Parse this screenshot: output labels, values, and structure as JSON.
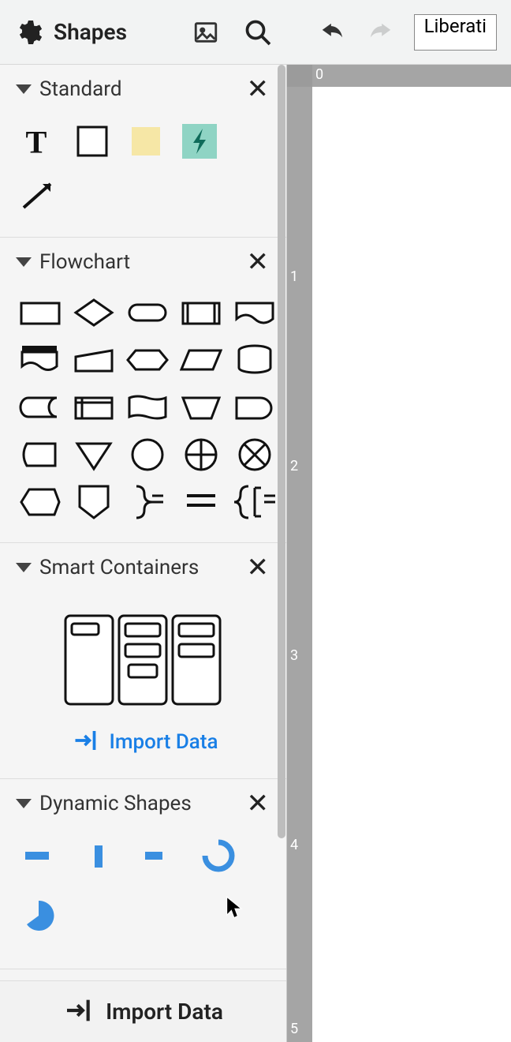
{
  "topbar": {
    "title": "Shapes",
    "font_select_value": "Liberati"
  },
  "sections": {
    "standard": {
      "title": "Standard",
      "shapes": [
        "text-tool",
        "rectangle",
        "sticky-note",
        "lightning",
        "arrow"
      ]
    },
    "flowchart": {
      "title": "Flowchart",
      "shapes": [
        "process",
        "decision",
        "terminator",
        "predefined-process",
        "document",
        "multi-document",
        "manual-input",
        "preparation",
        "data-io",
        "database",
        "stored-data",
        "internal-storage",
        "display",
        "manual-operation",
        "delay",
        "off-page",
        "merge",
        "connector",
        "summing-junction",
        "or-junction",
        "hexagon",
        "offpage-down",
        "brace-right",
        "parallel-lines",
        "brace-left-bracket"
      ]
    },
    "smart_containers": {
      "title": "Smart Containers",
      "import_label": "Import Data"
    },
    "dynamic_shapes": {
      "title": "Dynamic Shapes",
      "shapes": [
        "bar-h",
        "bar-v",
        "bar-short",
        "donut-arc",
        "pie-slice"
      ]
    }
  },
  "bottom_import_label": "Import Data",
  "ruler": {
    "h_ticks": [
      {
        "label": "0",
        "pos": 4
      }
    ],
    "v_ticks": [
      {
        "label": "1",
        "pos": 230
      },
      {
        "label": "2",
        "pos": 470
      },
      {
        "label": "3",
        "pos": 710
      },
      {
        "label": "4",
        "pos": 950
      },
      {
        "label": "5",
        "pos": 1183
      }
    ]
  }
}
